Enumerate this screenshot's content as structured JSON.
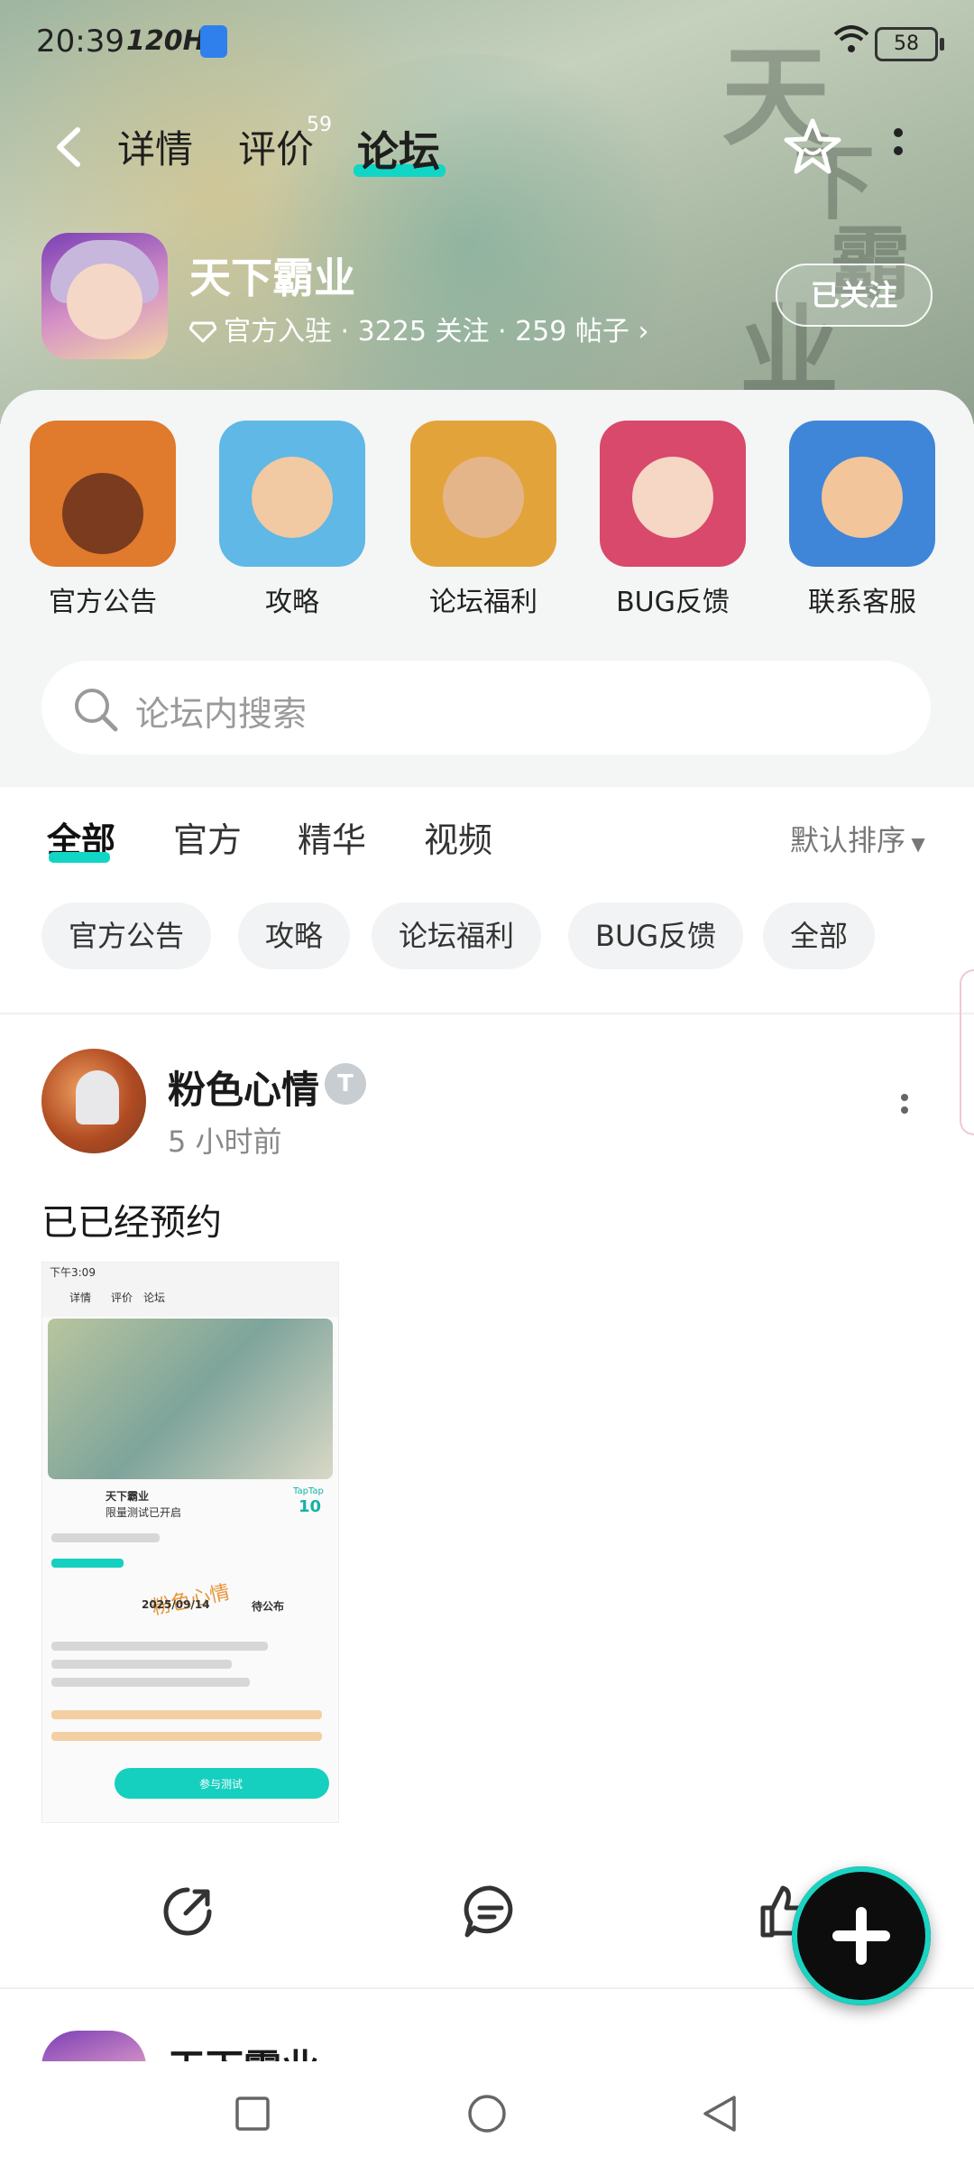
{
  "status_bar": {
    "time": "20:39",
    "refresh": "120Hz",
    "battery": "58"
  },
  "nav": {
    "tabs": [
      {
        "label": "详情"
      },
      {
        "label": "评价",
        "badge": "59"
      },
      {
        "label": "论坛",
        "active": true
      }
    ]
  },
  "game": {
    "title": "天下霸业",
    "meta": "官方入驻 · 3225 关注 · 259 帖子",
    "follow_label": "已关注"
  },
  "hero_calligraphy": [
    "天",
    "下",
    "霸",
    "业"
  ],
  "shortcuts": [
    {
      "label": "官方公告",
      "bg": "#e07a2c"
    },
    {
      "label": "攻略",
      "bg": "#5fb8e6"
    },
    {
      "label": "论坛福利",
      "bg": "#e2a43a"
    },
    {
      "label": "BUG反馈",
      "bg": "#d8496b"
    },
    {
      "label": "联系客服",
      "bg": "#3f86d8"
    }
  ],
  "search": {
    "placeholder": "论坛内搜索"
  },
  "feed": {
    "tabs": [
      "全部",
      "官方",
      "精华",
      "视频"
    ],
    "active_tab": "全部",
    "sort_label": "默认排序",
    "chips": [
      "官方公告",
      "攻略",
      "论坛福利",
      "BUG反馈",
      "全部"
    ]
  },
  "post": {
    "author": "粉色心情",
    "badge": "T",
    "time": "5 小时前",
    "text": "已已经预约",
    "screenshot": {
      "status_time": "下午3:09",
      "tabs": [
        "详情",
        "评价",
        "论坛"
      ],
      "game_name": "天下霸业",
      "subtitle": "限量测试已开启",
      "taptap": "TapTap",
      "score": "10",
      "date": "2025/09/14",
      "pending": "待公布",
      "watermark": "粉色心情",
      "button": "参与测试"
    }
  },
  "next_post": {
    "author": "天下霸业"
  },
  "colors": {
    "accent": "#11d6c6"
  }
}
